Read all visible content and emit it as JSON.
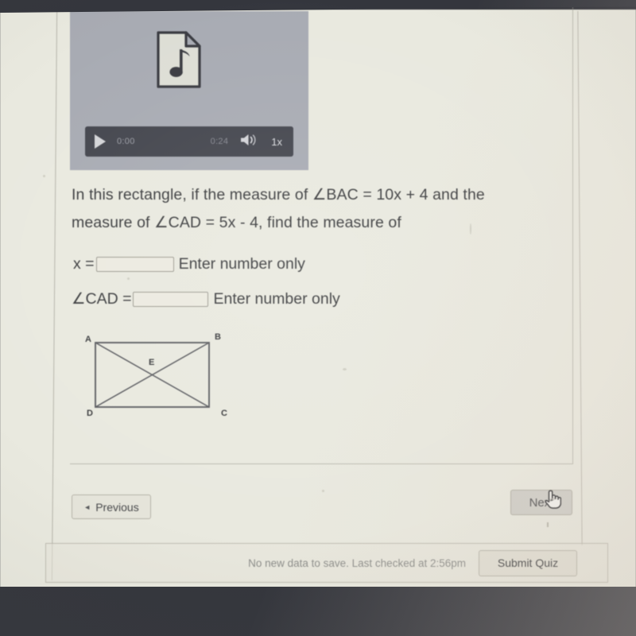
{
  "media_player": {
    "file_icon_name": "audio-file-icon",
    "play_button_label": "play-icon",
    "current_time": "0:00",
    "duration": "0:24",
    "volume_icon_name": "volume-on-icon",
    "playback_rate": "1x"
  },
  "question": {
    "prompt_line1": "In this rectangle, if the measure of ∠BAC = 10x + 4 and the",
    "prompt_line2": "measure of ∠CAD = 5x - 4, find the measure of",
    "fields": [
      {
        "label": "x =",
        "value": "",
        "placeholder": "",
        "hint": "Enter number only"
      },
      {
        "label": "∠CAD =",
        "value": "",
        "placeholder": "",
        "hint": "Enter number only"
      }
    ],
    "figure": {
      "type": "rectangle-with-diagonals",
      "vertex_labels": [
        "A",
        "B",
        "C",
        "D"
      ],
      "center_label": "E"
    }
  },
  "navigation": {
    "previous_label": "Previous",
    "previous_caret": "◄",
    "next_label": "Next",
    "cursor_icon_name": "pointing-hand-cursor"
  },
  "save_bar": {
    "status_text": "No new data to save. Last checked at 2:56pm",
    "submit_label": "Submit Quiz"
  },
  "colors": {
    "page_background": "#e9e9df",
    "media_background": "#a8abb3",
    "player_bar": "#44464e",
    "text": "#3c3d3f",
    "muted_text": "#8e8f8c",
    "bezel": "#34363d",
    "next_button": "#cfcec8"
  }
}
